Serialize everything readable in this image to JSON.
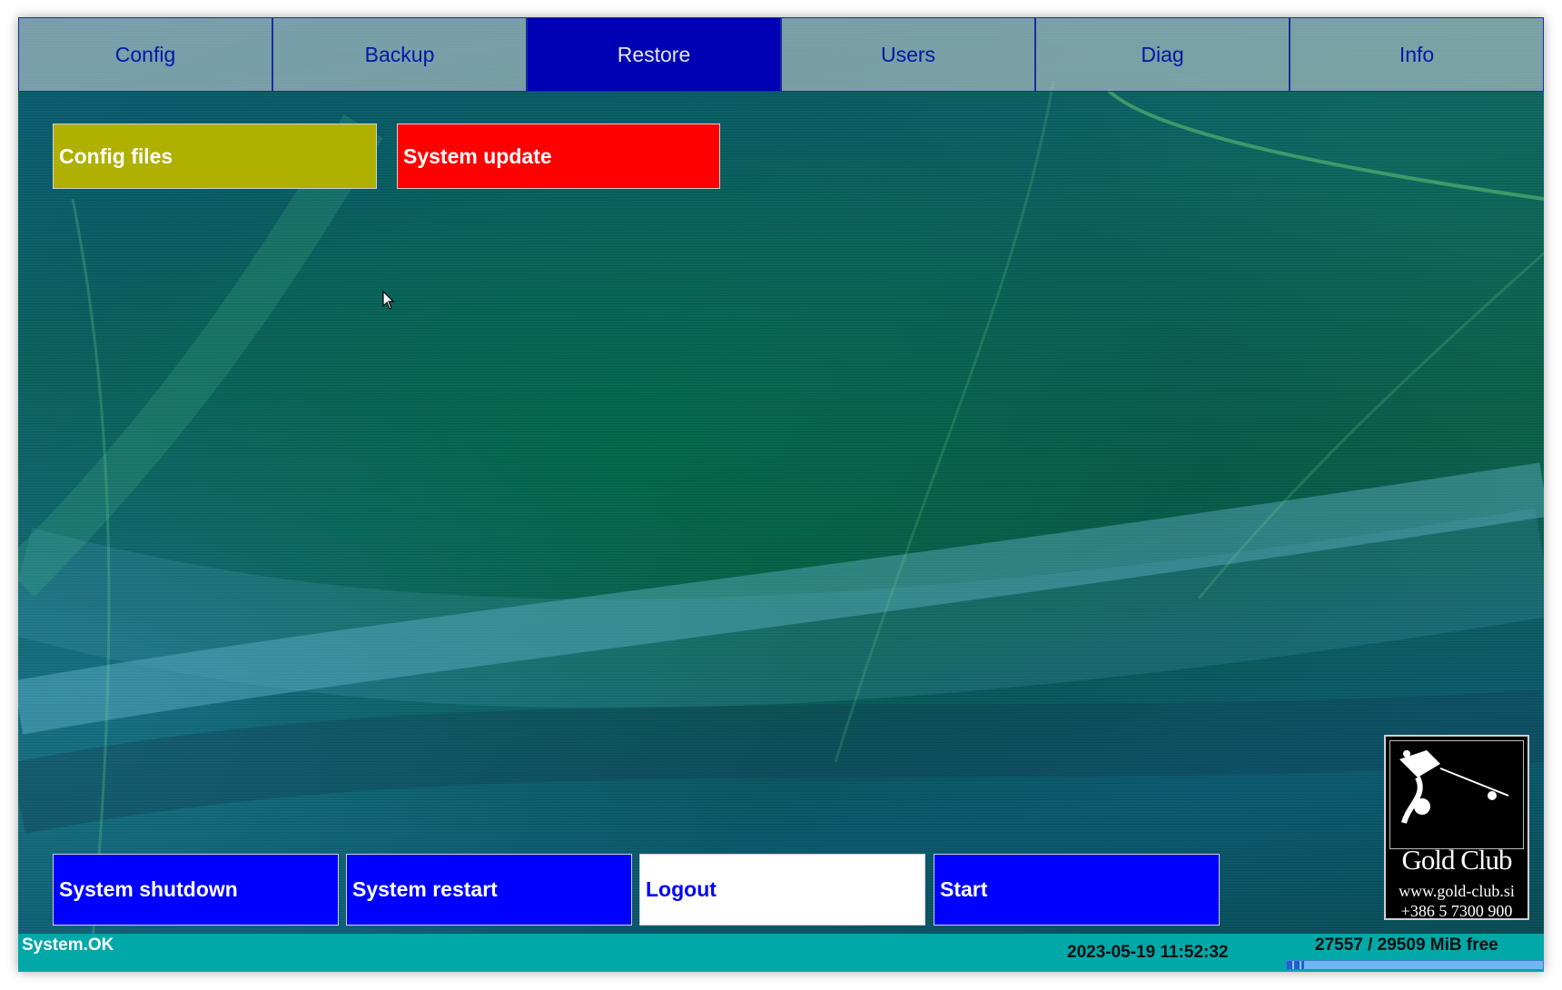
{
  "tabs": [
    {
      "label": "Config",
      "active": false
    },
    {
      "label": "Backup",
      "active": false
    },
    {
      "label": "Restore",
      "active": true
    },
    {
      "label": "Users",
      "active": false
    },
    {
      "label": "Diag",
      "active": false
    },
    {
      "label": "Info",
      "active": false
    }
  ],
  "actions": {
    "config_files": "Config files",
    "system_update": "System update"
  },
  "bottom_buttons": {
    "shutdown": "System shutdown",
    "restart": "System restart",
    "logout": "Logout",
    "start": "Start"
  },
  "logo": {
    "name": "Gold Club",
    "url": "www.gold-club.si",
    "phone": "+386 5 7300 900"
  },
  "status": {
    "message": "System.OK",
    "datetime": "2023-05-19 11:52:32",
    "disk_free": "27557 / 29509 MiB free",
    "disk_used_fraction": 0.066
  },
  "colors": {
    "tab_active": "#0000b4",
    "tab_text": "#0018a8",
    "config_files_bg": "#b0b000",
    "system_update_bg": "#ff0000",
    "button_blue": "#0000ff",
    "statusbar_bg": "#00a8a8"
  }
}
